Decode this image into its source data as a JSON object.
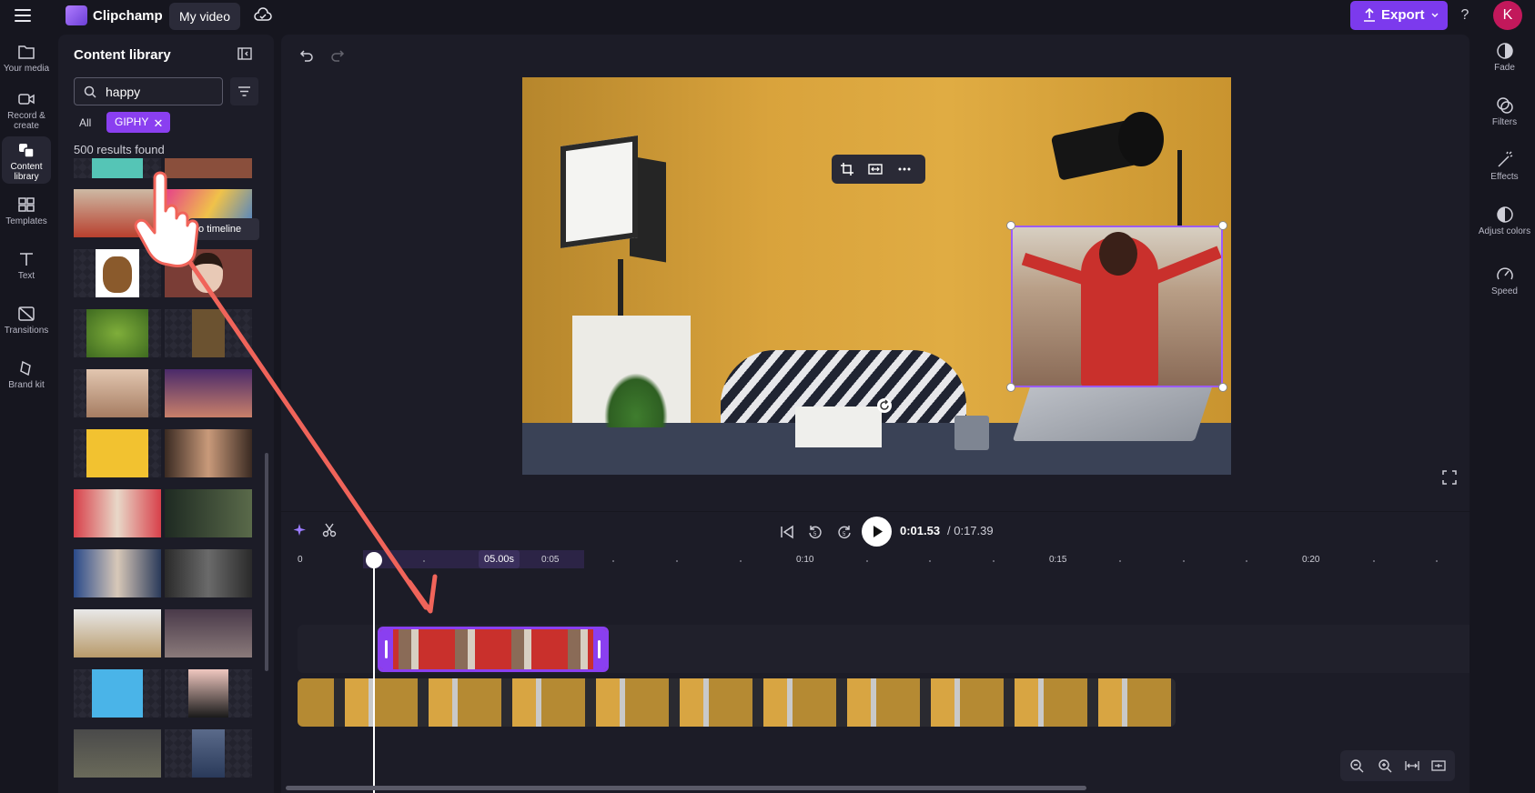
{
  "app": {
    "name": "Clipchamp",
    "project_title": "My video",
    "export_label": "Export",
    "help_label": "?",
    "avatar_initial": "K"
  },
  "left_nav": {
    "items": [
      {
        "label": "Your media",
        "icon": "folder-icon"
      },
      {
        "label": "Record & create",
        "icon": "camera-icon"
      },
      {
        "label": "Content library",
        "icon": "content-library-icon",
        "active": true
      },
      {
        "label": "Templates",
        "icon": "templates-icon"
      },
      {
        "label": "Text",
        "icon": "text-icon"
      },
      {
        "label": "Transitions",
        "icon": "transitions-icon"
      },
      {
        "label": "Brand kit",
        "icon": "brand-kit-icon"
      }
    ]
  },
  "library": {
    "title": "Content library",
    "search_value": "happy",
    "filter_all": "All",
    "filter_giphy": "GIPHY",
    "results_text": "500 results found",
    "tooltip_text": "to timeline"
  },
  "right_panel": {
    "items": [
      {
        "label": "Fade",
        "icon": "fade-icon"
      },
      {
        "label": "Filters",
        "icon": "filters-icon"
      },
      {
        "label": "Effects",
        "icon": "effects-icon"
      },
      {
        "label": "Adjust colors",
        "icon": "adjust-colors-icon"
      },
      {
        "label": "Speed",
        "icon": "speed-icon"
      }
    ]
  },
  "timeline": {
    "current_time": "0:01.53",
    "total_time": "/ 0:17.39",
    "duration_badge": "05.00s",
    "ruler_labels": [
      "0",
      "0:05",
      "0:10",
      "0:15",
      "0:20"
    ]
  },
  "colors": {
    "accent": "#7c3aed",
    "giphy_chip": "#8a3ff0",
    "annotation_arrow": "#f0645a",
    "avatar": "#c2185b"
  }
}
